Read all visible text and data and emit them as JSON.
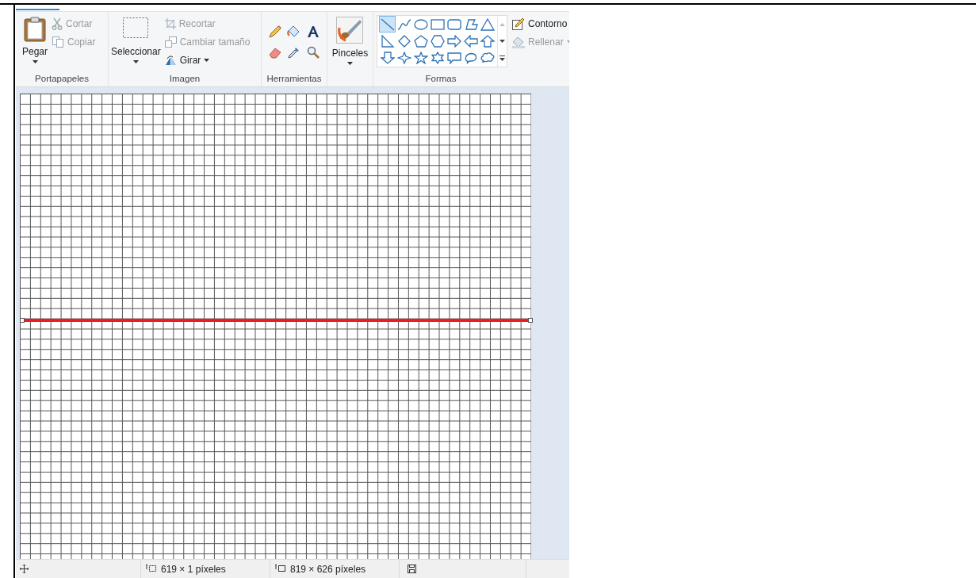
{
  "clipboard": {
    "paste": "Pegar",
    "cut": {
      "label": "Cortar",
      "disabled": true
    },
    "copy": {
      "label": "Copiar",
      "disabled": true
    },
    "label": "Portapapeles"
  },
  "image": {
    "select": "Seleccionar",
    "crop": {
      "label": "Recortar",
      "disabled": true
    },
    "resize": {
      "label": "Cambiar tamaño",
      "disabled": true
    },
    "rotate": {
      "label": "Girar",
      "disabled": false
    },
    "label": "Imagen"
  },
  "tools": {
    "label": "Herramientas"
  },
  "brushes": {
    "label": "Pinceles"
  },
  "shapes": {
    "label": "Formas",
    "items": [
      {
        "kind": "line",
        "selected": true
      },
      {
        "kind": "curve",
        "selected": false
      },
      {
        "kind": "oval",
        "selected": false
      },
      {
        "kind": "rectangle",
        "selected": false
      },
      {
        "kind": "rounded-rectangle",
        "selected": false
      },
      {
        "kind": "polygon",
        "selected": false
      },
      {
        "kind": "triangle",
        "selected": false
      },
      {
        "kind": "right-triangle",
        "selected": false
      },
      {
        "kind": "diamond",
        "selected": false
      },
      {
        "kind": "pentagon",
        "selected": false
      },
      {
        "kind": "hexagon",
        "selected": false
      },
      {
        "kind": "arrow-right",
        "selected": false
      },
      {
        "kind": "arrow-left",
        "selected": false
      },
      {
        "kind": "arrow-up",
        "selected": false
      },
      {
        "kind": "arrow-down",
        "selected": false
      },
      {
        "kind": "star-four",
        "selected": false
      },
      {
        "kind": "star-five",
        "selected": false
      },
      {
        "kind": "star-six",
        "selected": false
      },
      {
        "kind": "callout-rect",
        "selected": false
      },
      {
        "kind": "callout-oval",
        "selected": false
      },
      {
        "kind": "callout-cloud",
        "selected": false
      }
    ],
    "outline": {
      "label": "Contorno",
      "disabled": false
    },
    "fill": {
      "label": "Rellenar",
      "disabled": true
    }
  },
  "status_bar": {
    "selection_size": "619 × 1 píxeles",
    "canvas_size": "819 × 626 píxeles"
  }
}
